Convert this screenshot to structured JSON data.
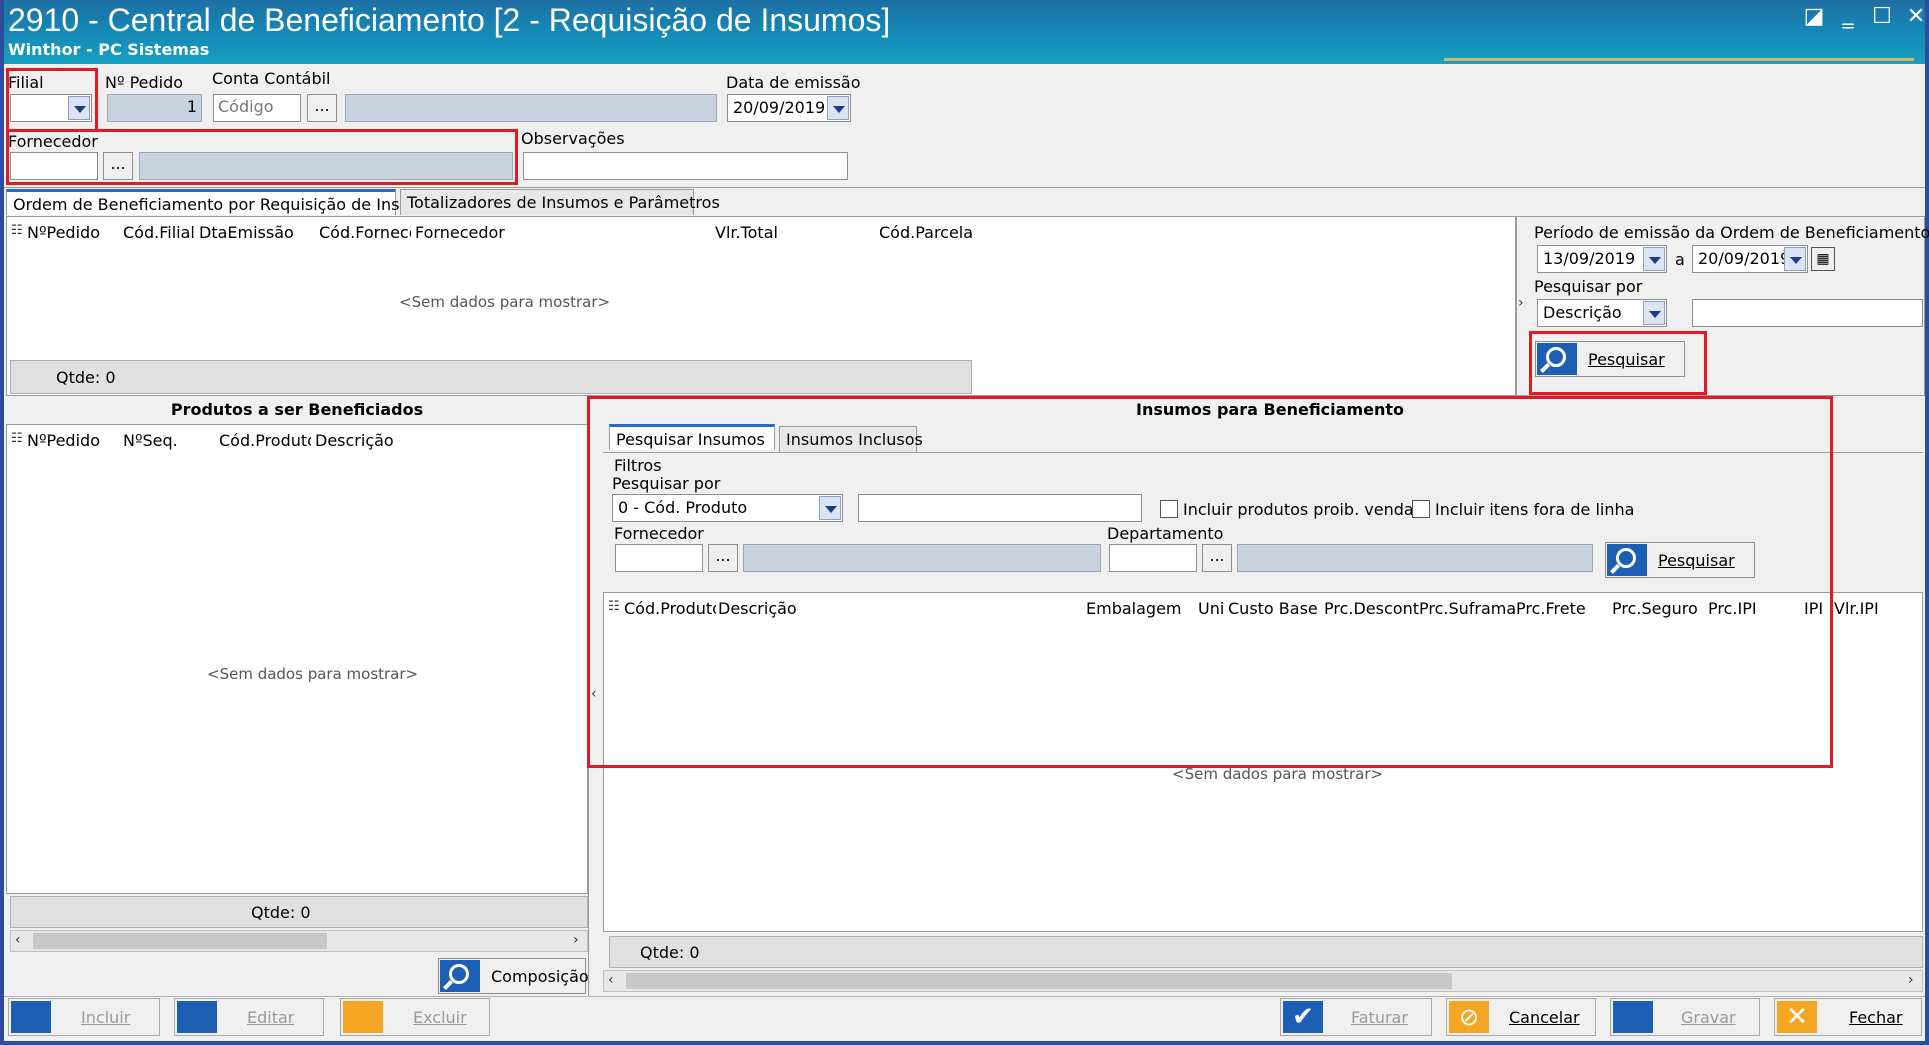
{
  "window": {
    "title": "2910 - Central de Beneficiamento [2 - Requisição de Insumos]",
    "subtitle": "Winthor - PC Sistemas"
  },
  "header": {
    "filial_label": "Filial",
    "filial_value": "",
    "num_pedido_label": "Nº Pedido",
    "num_pedido_value": "1",
    "conta_contabil_label": "Conta Contábil",
    "conta_codigo_placeholder": "Código",
    "browse_label": "...",
    "data_emissao_label": "Data de emissão",
    "data_emissao_value": "20/09/2019",
    "fornecedor_label": "Fornecedor",
    "fornecedor_value": "",
    "observacoes_label": "Observações",
    "observacoes_value": ""
  },
  "main_tabs": [
    {
      "label": "Ordem de Beneficiamento por Requisição de Insumos",
      "active": true
    },
    {
      "label": "Totalizadores de Insumos e Parâmetros",
      "active": false
    }
  ],
  "ordens_grid": {
    "columns": [
      "NºPedido",
      "Cód.Filial",
      "DtaEmissão",
      "Cód.Fornece",
      "Fornecedor",
      "Vlr.Total",
      "Cód.Parcela"
    ],
    "empty_text": "<Sem dados para mostrar>",
    "qtde_label": "Qtde: 0"
  },
  "filtro_periodo": {
    "label": "Período de emissão da Ordem de Beneficiamento",
    "data_inicio": "13/09/2019",
    "separator": "a",
    "data_fim": "20/09/2019",
    "pesquisar_por_label": "Pesquisar por",
    "pesquisar_por_value": "Descrição",
    "search_value": "",
    "pesquisar_button": "Pesquisar"
  },
  "produtos": {
    "title": "Produtos a ser Beneficiados",
    "columns": [
      "NºPedido",
      "NºSeq.",
      "Cód.Produto",
      "Descrição"
    ],
    "empty_text": "<Sem dados para mostrar>",
    "qtde_label": "Qtde: 0",
    "composicao_button": "Composição"
  },
  "insumos": {
    "title": "Insumos para Beneficiamento",
    "tabs": [
      {
        "label": "Pesquisar Insumos",
        "active": true
      },
      {
        "label": "Insumos Inclusos",
        "active": false
      }
    ],
    "filtros_label": "Filtros",
    "pesquisar_por_label": "Pesquisar por",
    "pesquisar_por_value": "0 - Cód. Produto",
    "search_value": "",
    "check_proib_label": "Incluir produtos proib. venda",
    "check_fora_linha_label": "Incluir itens fora de linha",
    "fornecedor_label": "Fornecedor",
    "departamento_label": "Departamento",
    "pesquisar_button": "Pesquisar",
    "columns": [
      "Cód.Produto",
      "Descrição",
      "Embalagem",
      "Uni",
      "Custo Base",
      "Prc.Descont",
      "Prc.Suframa",
      "Prc.Frete",
      "Prc.Seguro",
      "Prc.IPI",
      "IPI",
      "Vlr.IPI"
    ],
    "empty_text": "<Sem dados para mostrar>",
    "qtde_label": "Qtde: 0"
  },
  "toolbar": {
    "incluir": "Incluir",
    "editar": "Editar",
    "excluir": "Excluir",
    "faturar": "Faturar",
    "cancelar": "Cancelar",
    "gravar": "Gravar",
    "fechar": "Fechar"
  },
  "colors": {
    "title_bar": "#1586b4",
    "highlight_box": "#e01b24",
    "readonly_field": "#c8d3df",
    "search_icon": "#1d5fb4"
  }
}
